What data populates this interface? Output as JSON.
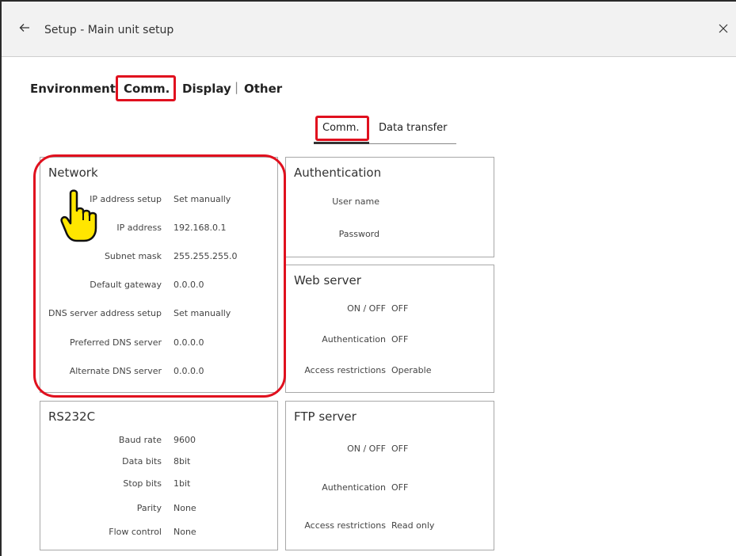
{
  "window": {
    "title": "Setup - Main unit setup"
  },
  "icons": {
    "back": "arrow-left-icon",
    "close": "close-icon",
    "pointer": "pointing-hand-icon"
  },
  "colors": {
    "highlight": "#e0101e",
    "pointer_fill": "#ffe600",
    "title_bar": "#f2f2f2"
  },
  "category_tabs": [
    {
      "label": "Environment",
      "selected": false
    },
    {
      "label": "Comm.",
      "selected": true
    },
    {
      "label": "Display",
      "selected": false
    },
    {
      "label": "Other",
      "selected": false
    }
  ],
  "category_separator": "|",
  "sub_tabs": [
    {
      "label": "Comm.",
      "selected": true
    },
    {
      "label": "Data transfer",
      "selected": false
    }
  ],
  "network": {
    "title": "Network",
    "rows": [
      {
        "label": "IP address setup",
        "value": "Set manually"
      },
      {
        "label": "IP address",
        "value": "192.168.0.1"
      },
      {
        "label": "Subnet mask",
        "value": "255.255.255.0"
      },
      {
        "label": "Default gateway",
        "value": "0.0.0.0"
      },
      {
        "label": "DNS server address setup",
        "value": "Set manually"
      },
      {
        "label": "Preferred DNS server",
        "value": "0.0.0.0"
      },
      {
        "label": "Alternate DNS server",
        "value": "0.0.0.0"
      }
    ]
  },
  "authentication": {
    "title": "Authentication",
    "rows": [
      {
        "label": "User name",
        "value": ""
      },
      {
        "label": "Password",
        "value": ""
      }
    ]
  },
  "web_server": {
    "title": "Web server",
    "rows": [
      {
        "label": "ON / OFF",
        "value": "OFF"
      },
      {
        "label": "Authentication",
        "value": "OFF"
      },
      {
        "label": "Access restrictions",
        "value": "Operable"
      }
    ]
  },
  "rs232c": {
    "title": "RS232C",
    "rows": [
      {
        "label": "Baud rate",
        "value": "9600"
      },
      {
        "label": "Data bits",
        "value": "8bit"
      },
      {
        "label": "Stop bits",
        "value": "1bit"
      },
      {
        "label": "Parity",
        "value": "None"
      },
      {
        "label": "Flow control",
        "value": "None"
      }
    ]
  },
  "ftp_server": {
    "title": "FTP server",
    "rows": [
      {
        "label": "ON / OFF",
        "value": "OFF"
      },
      {
        "label": "Authentication",
        "value": "OFF"
      },
      {
        "label": "Access restrictions",
        "value": "Read only"
      }
    ]
  }
}
